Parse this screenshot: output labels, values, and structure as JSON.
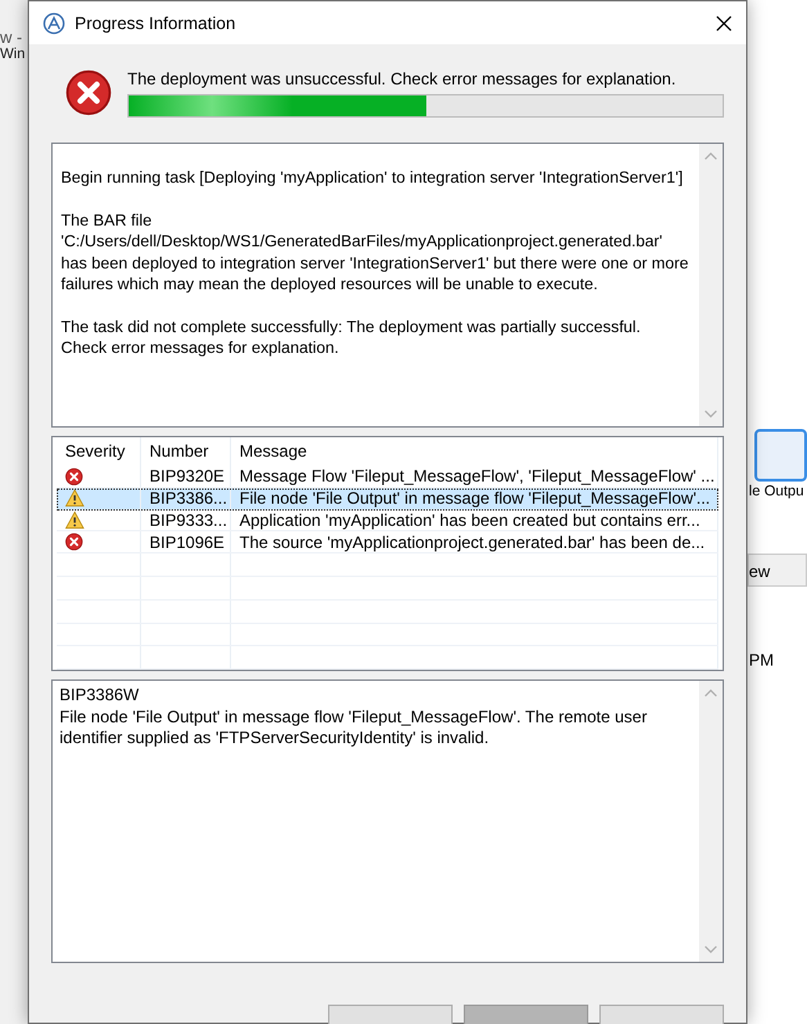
{
  "background": {
    "menu_fragments": [
      "w -",
      "Win"
    ],
    "node_label": "le Outpu",
    "tab": "ew",
    "cell": "PM"
  },
  "window": {
    "title": "Progress Information"
  },
  "status": {
    "kind": "error",
    "message": "The deployment was unsuccessful. Check error messages for explanation.",
    "level": 0.5
  },
  "log": [
    "Begin running task [Deploying 'myApplication' to integration server 'IntegrationServer1']",
    "The BAR file 'C:/Users/dell/Desktop/WS1/GeneratedBarFiles/myApplicationproject.generated.bar' has been deployed to integration server 'IntegrationServer1' but there were one or more failures which may mean the deployed resources will be unable to execute.",
    "The task did not complete successfully: The deployment was partially successful. Check error messages for explanation."
  ],
  "table": {
    "columns": [
      "Severity",
      "Number",
      "Message"
    ],
    "rows": [
      {
        "kind": "error",
        "number": "BIP9320E",
        "message": "Message Flow 'Fileput_MessageFlow', 'Fileput_MessageFlow' ...",
        "selected": false
      },
      {
        "kind": "warning",
        "number": "BIP3386...",
        "message": "File node 'File Output' in message flow 'Fileput_MessageFlow'...",
        "selected": true
      },
      {
        "kind": "warning",
        "number": "BIP9333...",
        "message": "Application 'myApplication' has been created but contains err...",
        "selected": false
      },
      {
        "kind": "error",
        "number": "BIP1096E",
        "message": "The source 'myApplicationproject.generated.bar' has been de...",
        "selected": false
      }
    ]
  },
  "detail": {
    "code": "BIP3386W",
    "text": "File node 'File Output' in message flow 'Fileput_MessageFlow'. The remote user identifier supplied as 'FTPServerSecurityIdentity' is invalid."
  },
  "buttons": [
    {
      "disabled": false
    },
    {
      "disabled": true
    },
    {
      "disabled": false
    }
  ]
}
